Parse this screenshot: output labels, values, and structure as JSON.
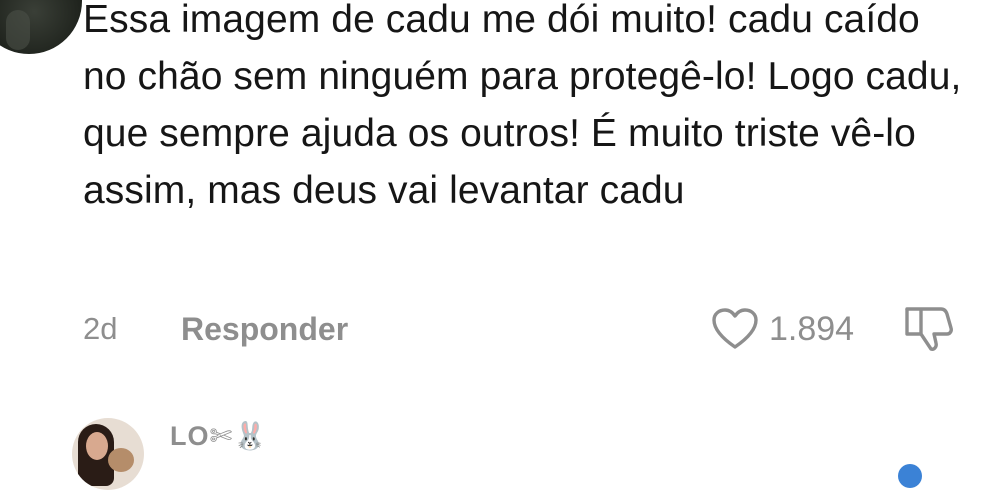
{
  "comment": {
    "text": "Essa imagem de cadu me dói muito! cadu caído no chão sem ninguém para protegê-lo! Logo cadu, que sempre ajuda os outros! É muito triste vê-lo assim, mas deus vai levantar cadu",
    "timestamp": "2d",
    "reply_label": "Responder",
    "like_count": "1.894",
    "icons": {
      "like": "heart-icon",
      "dislike": "thumbs-down-icon"
    }
  },
  "next_comment": {
    "username": "LO✄🐰"
  }
}
